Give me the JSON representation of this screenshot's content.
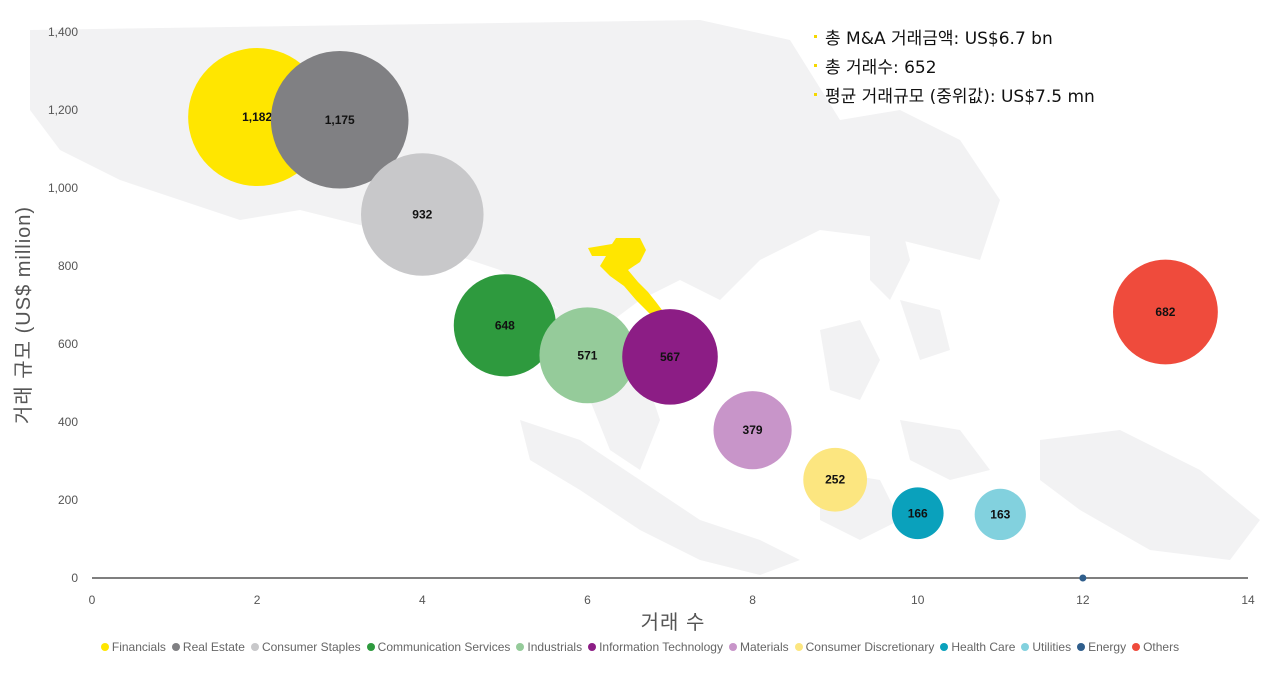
{
  "chart_data": {
    "type": "bubble",
    "xlabel": "거래 수",
    "ylabel": "거래 규모 (US$ million)",
    "xlim": [
      0,
      14
    ],
    "ylim": [
      0,
      1400
    ],
    "x_ticks": [
      "0",
      "2",
      "4",
      "6",
      "8",
      "10",
      "12",
      "14"
    ],
    "y_ticks": [
      "0",
      "200",
      "400",
      "600",
      "800",
      "1,000",
      "1,200",
      "1,400"
    ],
    "grid": false,
    "legend_position": "bottom",
    "background": "map of Southeast Asia with Vietnam highlighted in yellow",
    "series": [
      {
        "name": "Financials",
        "x": 2,
        "y": 1182,
        "label": "1,182",
        "color": "#FFE600",
        "size": 1182
      },
      {
        "name": "Real Estate",
        "x": 3,
        "y": 1175,
        "label": "1,175",
        "color": "#808083",
        "size": 1175
      },
      {
        "name": "Consumer Staples",
        "x": 4,
        "y": 932,
        "label": "932",
        "color": "#C8C8CA",
        "size": 932
      },
      {
        "name": "Communication Services",
        "x": 5,
        "y": 648,
        "label": "648",
        "color": "#2E9A3E",
        "size": 648
      },
      {
        "name": "Industrials",
        "x": 6,
        "y": 571,
        "label": "571",
        "color": "#95CB9A",
        "size": 571
      },
      {
        "name": "Information Technology",
        "x": 7,
        "y": 567,
        "label": "567",
        "color": "#8C1D85",
        "size": 567
      },
      {
        "name": "Materials",
        "x": 8,
        "y": 379,
        "label": "379",
        "color": "#C895C9",
        "size": 379
      },
      {
        "name": "Consumer Discretionary",
        "x": 9,
        "y": 252,
        "label": "252",
        "color": "#FCE680",
        "size": 252
      },
      {
        "name": "Health Care",
        "x": 10,
        "y": 166,
        "label": "166",
        "color": "#0AA1BC",
        "size": 166
      },
      {
        "name": "Utilities",
        "x": 11,
        "y": 163,
        "label": "163",
        "color": "#82D1DE",
        "size": 163
      },
      {
        "name": "Energy",
        "x": 12,
        "y": 0,
        "label": "",
        "color": "#2F5E8C",
        "size": 0
      },
      {
        "name": "Others",
        "x": 13,
        "y": 682,
        "label": "682",
        "color": "#EF4B3C",
        "size": 682
      }
    ]
  },
  "callouts": [
    "총 M&A 거래금액: US$6.7 bn",
    "총 거래수: 652",
    "평균 거래규모 (중위값): US$7.5 mn"
  ]
}
